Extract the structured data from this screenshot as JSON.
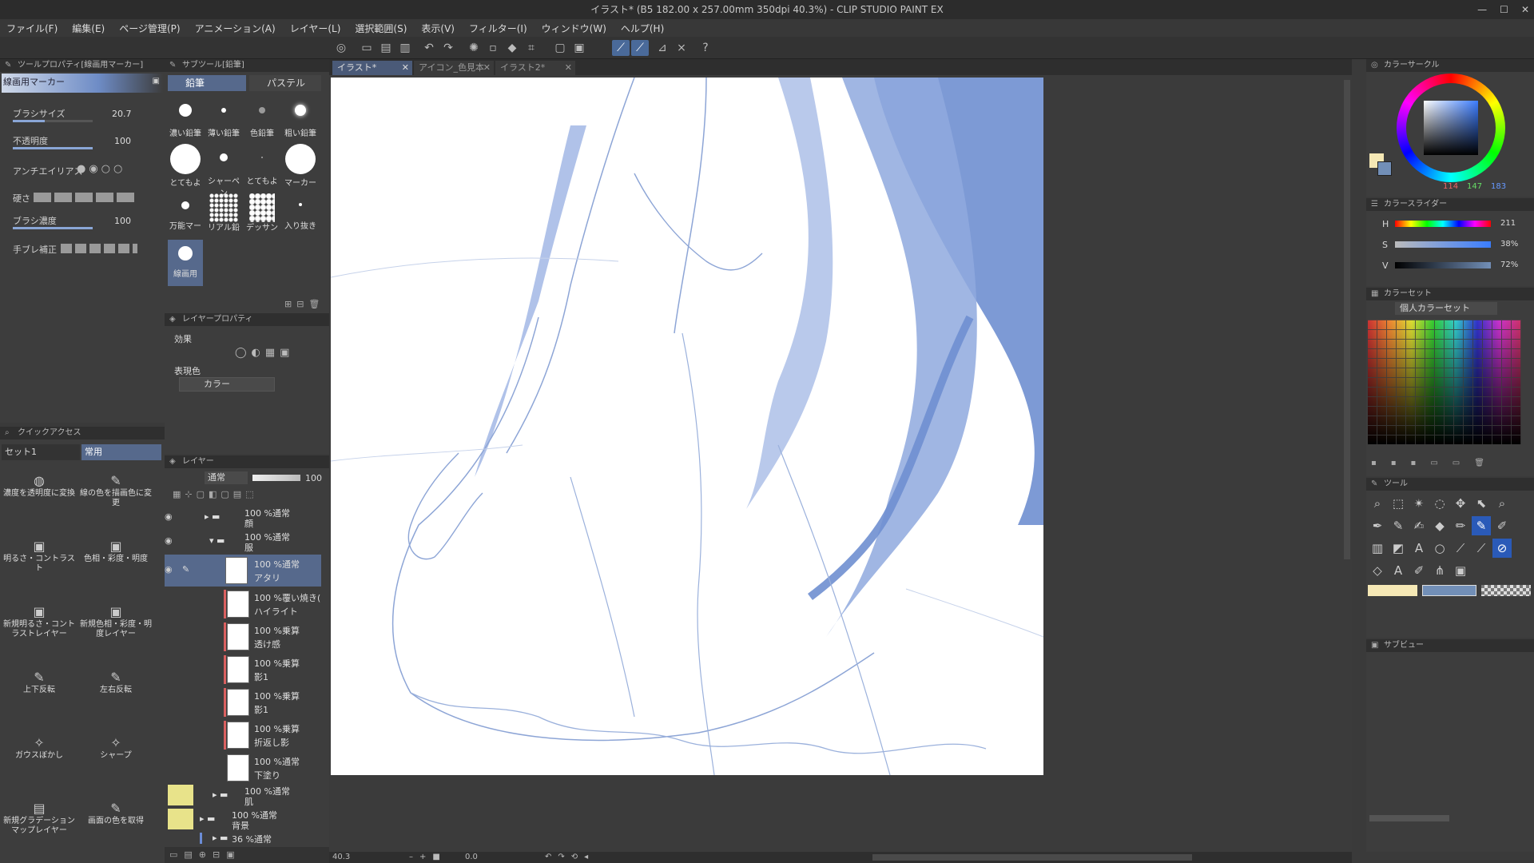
{
  "window": {
    "title": "イラスト* (B5 182.00 x 257.00mm 350dpi 40.3%) - CLIP STUDIO PAINT EX"
  },
  "menu": [
    "ファイル(F)",
    "編集(E)",
    "ページ管理(P)",
    "アニメーション(A)",
    "レイヤー(L)",
    "選択範囲(S)",
    "表示(V)",
    "フィルター(I)",
    "ウィンドウ(W)",
    "ヘルプ(H)"
  ],
  "tool_property": {
    "header": "ツールプロパティ[線画用マーカー]",
    "tool_name": "線画用マーカー",
    "brush_size_label": "ブラシサイズ",
    "brush_size": "20.7",
    "opacity_label": "不透明度",
    "opacity": "100",
    "antialias_label": "アンチエイリアス",
    "hardness_label": "硬さ",
    "brush_density_label": "ブラシ濃度",
    "brush_density": "100",
    "stabilization_label": "手ブレ補正"
  },
  "sub_tool": {
    "header": "サブツール[鉛筆]",
    "tabs": [
      "鉛筆",
      "パステル"
    ],
    "items": [
      "濃い鉛筆",
      "薄い鉛筆",
      "色鉛筆",
      "粗い鉛筆",
      "とてもよ",
      "シャーペン",
      "とてもよ",
      "マーカー",
      "万能マー",
      "リアル鉛",
      "デッサン",
      "入り抜き",
      "線画用"
    ]
  },
  "layer_property": {
    "header": "レイヤープロパティ",
    "effect_label": "効果",
    "expression_label": "表現色",
    "expression_value": "カラー"
  },
  "quick_access": {
    "header": "クイックアクセス",
    "set_name": "セット1",
    "tab": "常用",
    "items": [
      "濃度を透明度に変換",
      "線の色を描画色に変更",
      "明るさ・コントラスト",
      "色相・彩度・明度",
      "新規明るさ・コントラストレイヤー",
      "新規色相・彩度・明度レイヤー",
      "上下反転",
      "左右反転",
      "ガウスぼかし",
      "シャープ",
      "新規グラデーションマップレイヤー",
      "画面の色を取得"
    ]
  },
  "layers": {
    "header": "レイヤー",
    "blend_mode": "通常",
    "opacity": "100",
    "items": [
      {
        "meta": "100 %通常",
        "name": "顔"
      },
      {
        "meta": "100 %通常",
        "name": "服"
      },
      {
        "meta": "100 %通常",
        "name": "アタリ"
      },
      {
        "meta": "100 %覆い焼き(",
        "name": "ハイライト"
      },
      {
        "meta": "100 %乗算",
        "name": "透け感"
      },
      {
        "meta": "100 %乗算",
        "name": "影1"
      },
      {
        "meta": "100 %乗算",
        "name": "影1"
      },
      {
        "meta": "100 %乗算",
        "name": "折返し影"
      },
      {
        "meta": "100 %通常",
        "name": "下塗り"
      },
      {
        "meta": "100 %通常",
        "name": "肌"
      },
      {
        "meta": "100 %通常",
        "name": "背景"
      },
      {
        "meta": "36 %通常",
        "name": ""
      }
    ]
  },
  "canvas_tabs": [
    "イラスト*",
    "アイコン_色見本",
    "イラスト2*"
  ],
  "status": {
    "zoom": "40.3",
    "angle": "0.0"
  },
  "color_wheel": {
    "header": "カラーサークル",
    "r": "114",
    "g": "147",
    "b": "183",
    "main": "#728fb7",
    "sub": "#f5e8b5"
  },
  "color_slider": {
    "header": "カラースライダー",
    "h_label": "H",
    "h": "211",
    "s_label": "S",
    "s": "38%",
    "v_label": "V",
    "v": "72%"
  },
  "color_set": {
    "header": "カラーセット",
    "set_name": "個人カラーセット"
  },
  "tool": {
    "header": "ツール"
  },
  "sub_view": {
    "header": "サブビュー"
  }
}
